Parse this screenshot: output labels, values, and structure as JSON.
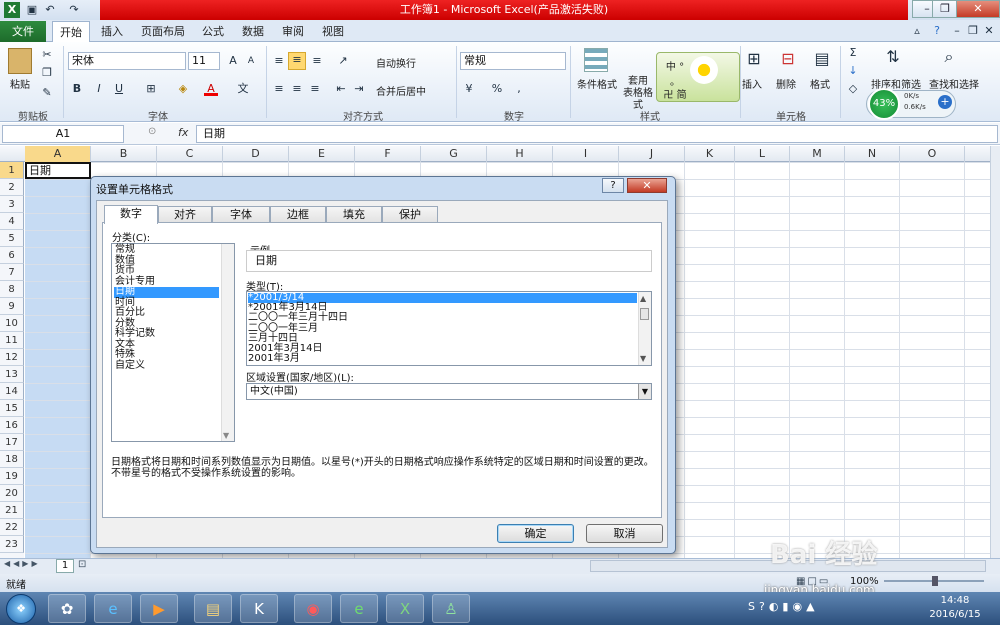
{
  "window": {
    "title": "工作簿1 - Microsoft Excel(产品激活失败)",
    "minimize": "–",
    "restore": "❐",
    "close": "✕"
  },
  "ribbon": {
    "file_tab": "文件",
    "tabs": [
      "开始",
      "插入",
      "页面布局",
      "公式",
      "数据",
      "审阅",
      "视图"
    ],
    "clipboard": {
      "paste": "粘贴",
      "group": "剪贴板"
    },
    "font": {
      "name": "宋体",
      "size": "11",
      "group": "字体"
    },
    "alignment": {
      "wrap": "自动换行",
      "merge": "合并后居中",
      "group": "对齐方式"
    },
    "number": {
      "format": "常规",
      "group": "数字",
      "percent": "%"
    },
    "styles": {
      "conditional": "条件格式",
      "table": "套用\n表格格式",
      "group": "样式"
    },
    "cells": {
      "insert": "插入",
      "delete": "删除",
      "format": "格式",
      "group": "单元格"
    },
    "editing": {
      "sort": "排序和筛选",
      "find": "查找和选择"
    },
    "widget": {
      "percent": "43%",
      "up": "0K/s",
      "down": "0.6K/s",
      "text1": "中 ° 。",
      "text2": "卍 简"
    }
  },
  "formula_bar": {
    "name_box": "A1",
    "fx": "fx",
    "content": "日期"
  },
  "sheet": {
    "columns": [
      "A",
      "B",
      "C",
      "D",
      "E",
      "F",
      "G",
      "H",
      "I",
      "J",
      "K",
      "L",
      "M",
      "N",
      "O"
    ],
    "rows": [
      "1",
      "2",
      "3",
      "4",
      "5",
      "6",
      "7",
      "8",
      "9",
      "10",
      "11",
      "12",
      "13",
      "14",
      "15",
      "16",
      "17",
      "18",
      "19",
      "20",
      "21",
      "22",
      "23"
    ],
    "a1_value": "日期",
    "sheet_tab": "1"
  },
  "status": {
    "ready": "就绪",
    "zoom": "100%"
  },
  "taskbar": {
    "time": "14:48",
    "date": "2016/6/15"
  },
  "watermark": {
    "line1": "Bai 经验",
    "line2": "jingyan.baidu.com"
  },
  "dialog": {
    "title": "设置单元格格式",
    "help": "?",
    "close": "✕",
    "tabs": [
      "数字",
      "对齐",
      "字体",
      "边框",
      "填充",
      "保护"
    ],
    "category_label": "分类(C):",
    "categories": [
      "常规",
      "数值",
      "货币",
      "会计专用",
      "日期",
      "时间",
      "百分比",
      "分数",
      "科学记数",
      "文本",
      "特殊",
      "自定义"
    ],
    "selected_category": "日期",
    "sample_label": "示例",
    "sample_value": "日期",
    "type_label": "类型(T):",
    "types": [
      "*2001/3/14",
      "*2001年3月14日",
      "二〇〇一年三月十四日",
      "二〇〇一年三月",
      "三月十四日",
      "2001年3月14日",
      "2001年3月"
    ],
    "locale_label": "区域设置(国家/地区)(L):",
    "locale_value": "中文(中国)",
    "description": "日期格式将日期和时间系列数值显示为日期值。以星号(*)开头的日期格式响应操作系统特定的区域日期和时间设置的更改。不带星号的格式不受操作系统设置的影响。",
    "ok": "确定",
    "cancel": "取消"
  }
}
